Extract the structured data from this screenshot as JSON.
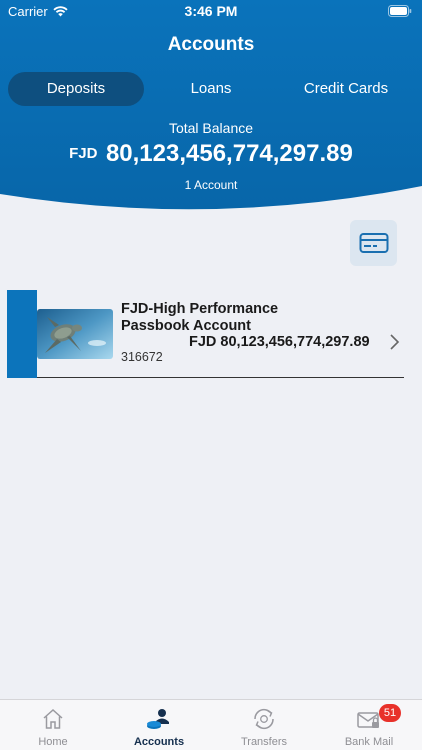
{
  "status_bar": {
    "carrier": "Carrier",
    "time": "3:46 PM"
  },
  "header": {
    "title": "Accounts",
    "tabs": [
      {
        "label": "Deposits",
        "active": true
      },
      {
        "label": "Loans",
        "active": false
      },
      {
        "label": "Credit Cards",
        "active": false
      }
    ],
    "balance_label": "Total Balance",
    "balance_currency": "FJD",
    "balance_amount": "80,123,456,774,297.89",
    "account_count": "1 Account"
  },
  "accounts": [
    {
      "name": "FJD-High Performance Passbook Account",
      "balance": "FJD 80,123,456,774,297.89",
      "number": "316672",
      "thumbnail": "sea-turtle-image"
    }
  ],
  "tabbar": [
    {
      "label": "Home",
      "icon": "home-icon",
      "active": false
    },
    {
      "label": "Accounts",
      "icon": "accounts-icon",
      "active": true
    },
    {
      "label": "Transfers",
      "icon": "transfers-icon",
      "active": false
    },
    {
      "label": "Bank Mail",
      "icon": "mail-icon",
      "active": false,
      "badge": "51"
    }
  ],
  "colors": {
    "header_blue": "#0a6db3",
    "active_tab": "#0e4f7f",
    "stripe": "#0c74bb",
    "badge": "#e8312a"
  }
}
